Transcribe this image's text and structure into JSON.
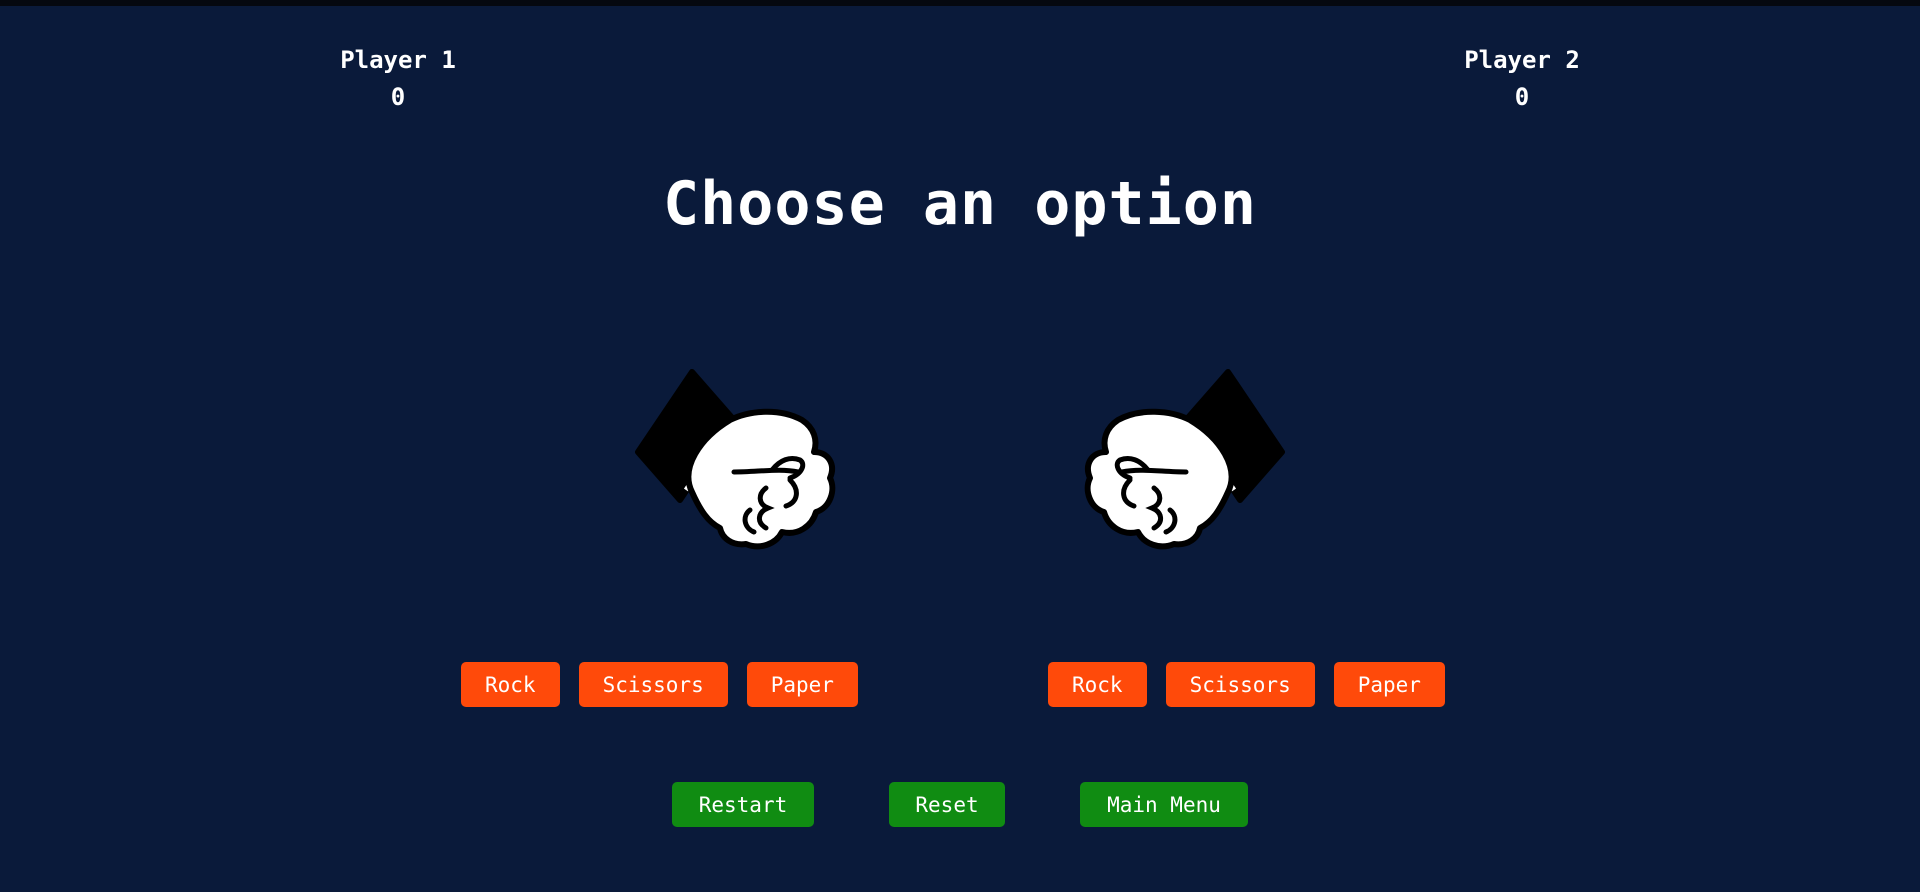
{
  "players": [
    {
      "name": "Player 1",
      "score": "0"
    },
    {
      "name": "Player 2",
      "score": "0"
    }
  ],
  "title": "Choose an option",
  "choices": {
    "player1": [
      "Rock",
      "Scissors",
      "Paper"
    ],
    "player2": [
      "Rock",
      "Scissors",
      "Paper"
    ]
  },
  "hands": {
    "left": "rock-fist-icon",
    "right": "rock-fist-icon"
  },
  "controls": {
    "restart": "Restart",
    "reset": "Reset",
    "main_menu": "Main Menu"
  },
  "colors": {
    "background": "#0a1a3a",
    "choice_button": "#ff4a0a",
    "control_button": "#108c12",
    "text": "#ffffff"
  }
}
